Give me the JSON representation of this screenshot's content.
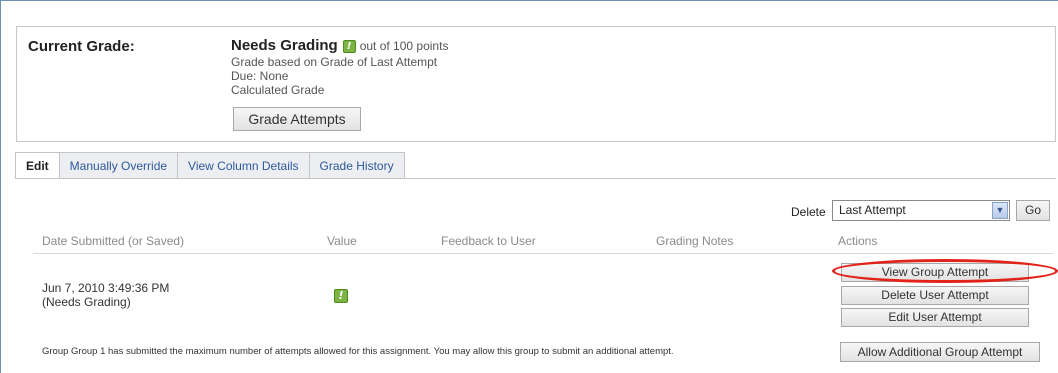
{
  "grade": {
    "label": "Current Grade:",
    "status": "Needs Grading",
    "out_of": "out of 100 points",
    "based_on": "Grade based on Grade of Last Attempt",
    "due": "Due: None",
    "calculated": "Calculated Grade",
    "grade_attempts_button": "Grade Attempts"
  },
  "tabs": [
    {
      "label": "Edit",
      "active": true
    },
    {
      "label": "Manually Override"
    },
    {
      "label": "View Column Details"
    },
    {
      "label": "Grade History"
    }
  ],
  "delete": {
    "label": "Delete",
    "selected": "Last Attempt",
    "go_label": "Go"
  },
  "table": {
    "headers": [
      "Date Submitted (or Saved)",
      "Value",
      "Feedback to User",
      "Grading Notes",
      "Actions"
    ],
    "row": {
      "date": "Jun 7, 2010 3:49:36 PM",
      "status": "(Needs Grading)"
    },
    "actions": [
      "View Group Attempt",
      "Delete User Attempt",
      "Edit User Attempt"
    ]
  },
  "note": "Group Group 1 has submitted the maximum number of attempts allowed for this assignment. You may allow this group to submit an additional attempt.",
  "allow_button": "Allow Additional Group Attempt",
  "icons": {
    "needs_grading": "exclamation-icon",
    "dropdown": "chevron-down-icon"
  },
  "colors": {
    "needs_grading_icon": "#7cb342",
    "highlight": "#e2231a",
    "tab_link": "#2d5a9c"
  }
}
